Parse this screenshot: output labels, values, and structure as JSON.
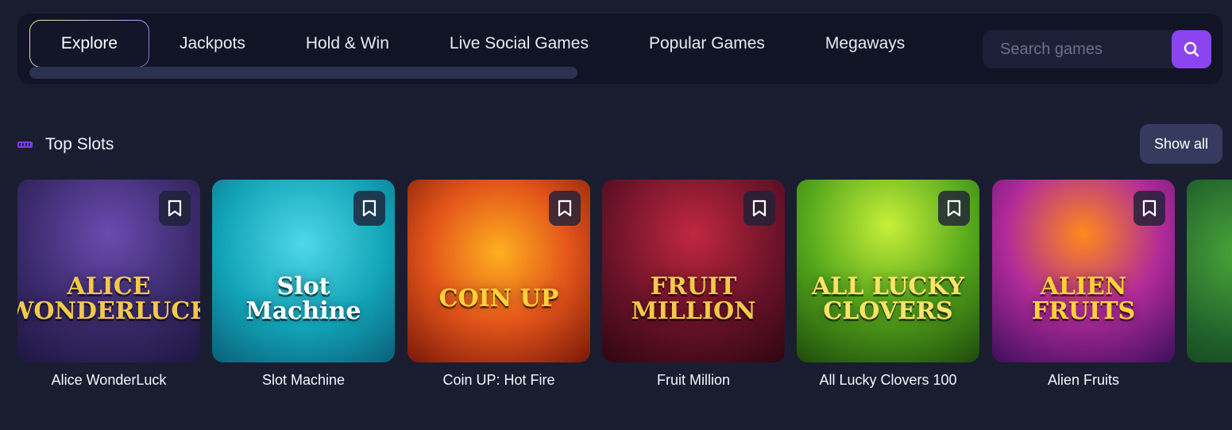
{
  "tabs": [
    {
      "label": "Explore",
      "active": true
    },
    {
      "label": "Jackpots"
    },
    {
      "label": "Hold & Win"
    },
    {
      "label": "Live Social Games"
    },
    {
      "label": "Popular Games"
    },
    {
      "label": "Megaways"
    }
  ],
  "search": {
    "placeholder": "Search games",
    "button_icon": "search-icon"
  },
  "section": {
    "title": "Top Slots",
    "show_all": "Show all",
    "icon": "slot-section-icon"
  },
  "games": [
    {
      "name": "Alice WonderLuck",
      "art": "ALICE WONDERLUCK",
      "bg": "#3a2a6a",
      "accent": "#f2c94c"
    },
    {
      "name": "Slot Machine",
      "art": "Slot Machine",
      "bg": "#12a4b8",
      "accent": "#ffffff"
    },
    {
      "name": "Coin UP: Hot Fire",
      "art": "COIN UP",
      "bg": "#d8410f",
      "accent": "#ffd23a"
    },
    {
      "name": "Fruit Million",
      "art": "FRUIT MILLION",
      "bg": "#5a0f22",
      "accent": "#f2c94c"
    },
    {
      "name": "All Lucky Clovers 100",
      "art": "ALL LUCKY CLOVERS",
      "bg": "#3f8f18",
      "accent": "#ffe36a"
    },
    {
      "name": "Alien Fruits",
      "art": "ALIEN FRUITS",
      "bg": "#7a2a9a",
      "accent": "#ffd23a"
    },
    {
      "name": "",
      "art": "",
      "bg": "#1f5e2a",
      "accent": "#f2c94c"
    }
  ],
  "colors": {
    "page_bg": "#1a1d30",
    "topbar_bg": "#111424",
    "search_button": "#8b44f0",
    "show_all_bg": "#353a5e"
  }
}
